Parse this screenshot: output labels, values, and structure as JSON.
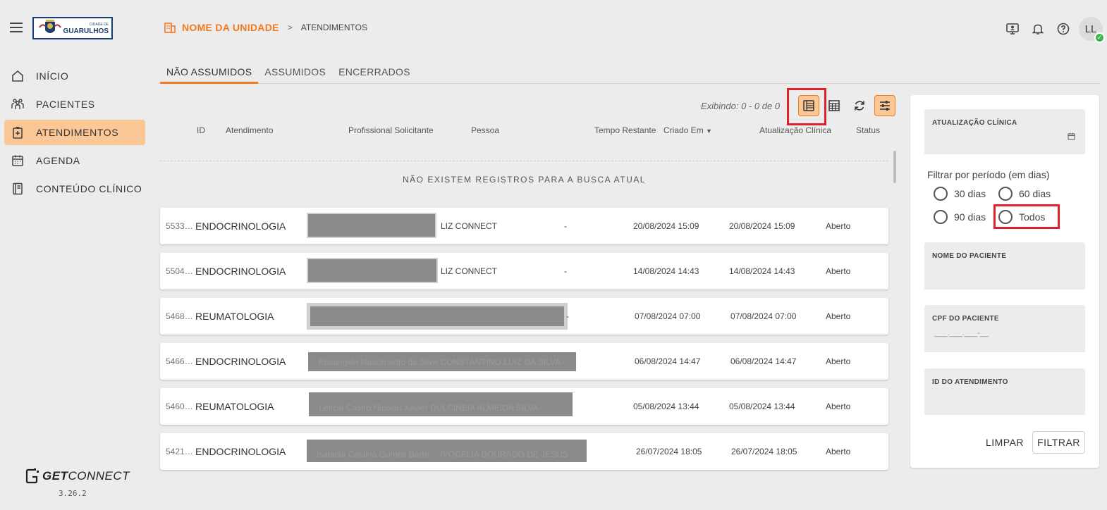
{
  "header": {
    "logo_text": "GUARULHOS",
    "logo_sub": "CIDADE DE",
    "unit_name": "NOME DA UNIDADE",
    "separator": ">",
    "crumb": "ATENDIMENTOS",
    "avatar_initials": "LL"
  },
  "sidebar": {
    "items": [
      {
        "label": "INÍCIO",
        "icon": "home-icon"
      },
      {
        "label": "PACIENTES",
        "icon": "people-icon"
      },
      {
        "label": "ATENDIMENTOS",
        "icon": "clipboard-icon"
      },
      {
        "label": "AGENDA",
        "icon": "calendar-icon"
      },
      {
        "label": "CONTEÚDO CLÍNICO",
        "icon": "book-icon"
      }
    ],
    "active_index": 2,
    "brand_get": "GET",
    "brand_connect": "CONNECT",
    "version": "3.26.2"
  },
  "tabs": [
    {
      "label": "NÃO ASSUMIDOS",
      "active": true
    },
    {
      "label": "ASSUMIDOS",
      "active": false
    },
    {
      "label": "ENCERRADOS",
      "active": false
    }
  ],
  "toolbar": {
    "exibindo": "Exibindo: 0 - 0 de 0"
  },
  "table": {
    "columns": [
      "ID",
      "Atendimento",
      "Profissional Solicitante",
      "Pessoa",
      "Tempo Restante",
      "Criado Em",
      "Atualização Clínica",
      "Status"
    ],
    "empty_message": "NÃO EXISTEM REGISTROS PARA A BUSCA ATUAL",
    "rows": [
      {
        "id": "5533…",
        "atendimento": "ENDOCRINOLOGIA",
        "redacted_text": "",
        "pessoa": "LIZ CONNECT",
        "tempo": "-",
        "criado": "20/08/2024 15:09",
        "atualizacao": "20/08/2024 15:09",
        "status": "Aberto"
      },
      {
        "id": "5504…",
        "atendimento": "ENDOCRINOLOGIA",
        "redacted_text": "",
        "pessoa": "LIZ CONNECT",
        "tempo": "-",
        "criado": "14/08/2024 14:43",
        "atualizacao": "14/08/2024 14:43",
        "status": "Aberto"
      },
      {
        "id": "5468…",
        "atendimento": "REUMATOLOGIA",
        "redacted_text": "",
        "pessoa": "",
        "tempo": "-",
        "criado": "07/08/2024 07:00",
        "atualizacao": "07/08/2024 07:00",
        "status": "Aberto"
      },
      {
        "id": "5466…",
        "atendimento": "ENDOCRINOLOGIA",
        "redacted_text": "Rosangela Nascimento da Silva CONSTANTINO LUIZ DA SILVA  -",
        "pessoa": "",
        "tempo": "",
        "criado": "06/08/2024 14:47",
        "atualizacao": "06/08/2024 14:47",
        "status": "Aberto"
      },
      {
        "id": "5460…",
        "atendimento": "REUMATOLOGIA",
        "redacted_text": "Letícia Castro Nicolau Xavier   DULCINEIA ALMEIDA SILVA    -",
        "pessoa": "",
        "tempo": "",
        "criado": "05/08/2024 13:44",
        "atualizacao": "05/08/2024 13:44",
        "status": "Aberto"
      },
      {
        "id": "5421…",
        "atendimento": "ENDOCRINOLOGIA",
        "redacted_text": "Isabella Cristina Gomes Barre…  IVOCELIA DOURADO DE JESUS  -",
        "pessoa": "",
        "tempo": "",
        "criado": "26/07/2024 18:05",
        "atualizacao": "26/07/2024 18:05",
        "status": "Aberto"
      }
    ]
  },
  "filters": {
    "atualizacao_label": "ATUALIZAÇÃO CLÍNICA",
    "period_label": "Filtrar por período (em dias)",
    "period_options": [
      "30 dias",
      "60 dias",
      "90 dias",
      "Todos"
    ],
    "nome_label": "NOME DO PACIENTE",
    "cpf_label": "CPF DO PACIENTE",
    "cpf_placeholder": "___.___.___-__",
    "id_label": "ID DO ATENDIMENTO",
    "limpar": "LIMPAR",
    "filtrar": "FILTRAR"
  },
  "colors": {
    "accent": "#f47a20",
    "active_bg": "#fcc797",
    "highlight_box": "#e0202a",
    "redaction": "#8a8a8a"
  }
}
